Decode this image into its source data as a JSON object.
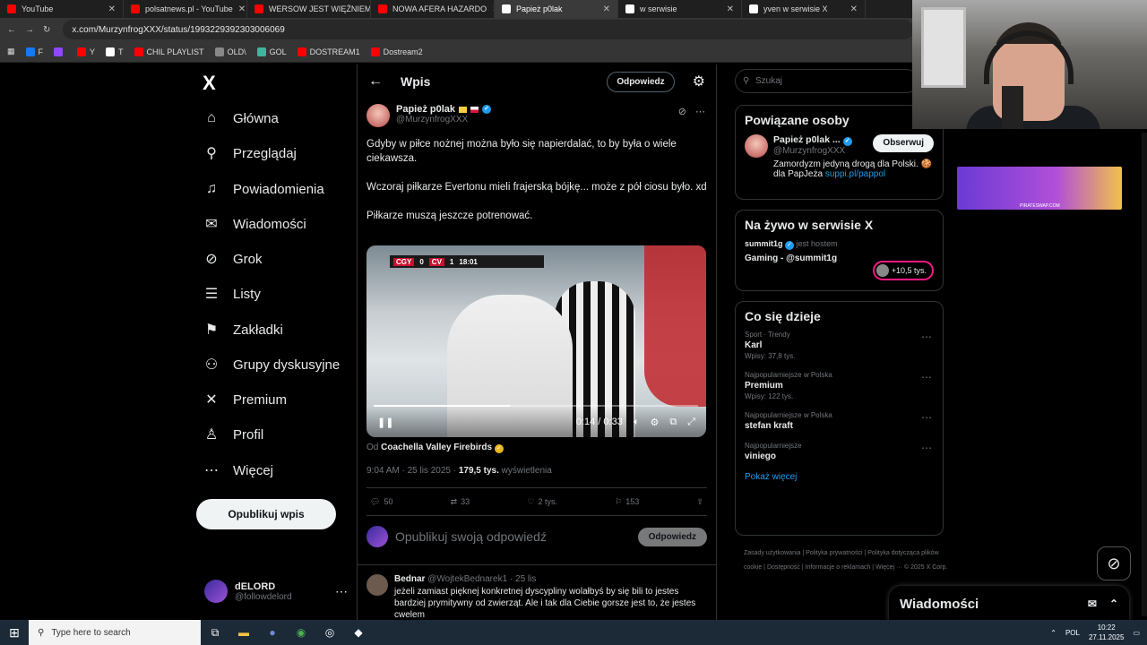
{
  "browser": {
    "tabs": [
      {
        "title": "YouTube",
        "color": "#ff0000",
        "active": false
      },
      {
        "title": "polsatnews.pl - YouTube",
        "color": "#ff0000",
        "active": false
      },
      {
        "title": "WERSOW JEST WIĘŹNIEM",
        "color": "#ff0000",
        "active": false
      },
      {
        "title": "NOWA AFERA HAZARDO",
        "color": "#ff0000",
        "active": false
      },
      {
        "title": "Papież p0lak",
        "color": "#ffffff",
        "active": true
      },
      {
        "title": "w serwisie",
        "color": "#ffffff",
        "active": false
      },
      {
        "title": "yven w serwisie X",
        "color": "#ffffff",
        "active": false
      }
    ],
    "url": "x.com/MurzynfrogXXX/status/1993229392303006069",
    "bookmarks": [
      {
        "label": "F",
        "color": "#1877f2"
      },
      {
        "label": "",
        "color": "#9146ff"
      },
      {
        "label": "Y",
        "color": "#ff0000"
      },
      {
        "label": "T",
        "color": "#ffffff"
      },
      {
        "label": "CHIL PLAYLIST",
        "color": "#ff0000"
      },
      {
        "label": "OLD\\",
        "color": "#888888"
      },
      {
        "label": "GOL",
        "color": "#3fb5a0"
      },
      {
        "label": "DOSTREAM1",
        "color": "#ff0000"
      },
      {
        "label": "Dostream2",
        "color": "#ff0000"
      }
    ]
  },
  "nav": {
    "logo": "X",
    "items": [
      {
        "label": "Główna",
        "icon": "⌂"
      },
      {
        "label": "Przeglądaj",
        "icon": "⚲"
      },
      {
        "label": "Powiadomienia",
        "icon": "♫"
      },
      {
        "label": "Wiadomości",
        "icon": "✉"
      },
      {
        "label": "Grok",
        "icon": "⊘"
      },
      {
        "label": "Listy",
        "icon": "☰"
      },
      {
        "label": "Zakładki",
        "icon": "⚑"
      },
      {
        "label": "Grupy dyskusyjne",
        "icon": "⚇"
      },
      {
        "label": "Premium",
        "icon": "✕"
      },
      {
        "label": "Profil",
        "icon": "♙"
      },
      {
        "label": "Więcej",
        "icon": "⋯"
      }
    ],
    "post_button": "Opublikuj wpis",
    "me": {
      "name": "dELORD",
      "handle": "@followdelord"
    }
  },
  "post": {
    "header_title": "Wpis",
    "reply_label": "Odpowiedz",
    "author_name": "Papież p0lak",
    "author_handle": "@MurzynfrogXXX",
    "text": [
      "Gdyby w piłce nożnej można było się napierdalać, to by była o wiele ciekawsza.",
      "Wczoraj piłkarze Evertonu mieli frajerską bójkę... może z pół ciosu było. xd",
      "Piłkarze muszą jeszcze potrenować."
    ],
    "video": {
      "team1": "CGY",
      "score1": "0",
      "team2": "CV",
      "score2": "1",
      "clock": "18:01",
      "time": "0:14 / 0:33",
      "progress": 0.42
    },
    "from_prefix": "Od",
    "from_name": "Coachella Valley Firebirds",
    "time": "9:04 AM · 25 lis 2025 ·",
    "views": "179,5 tys.",
    "views_label": "wyświetlenia",
    "stats": {
      "replies": "50",
      "reposts": "33",
      "likes": "2 tys.",
      "bookmarks": "153"
    },
    "reply_placeholder": "Opublikuj swoją odpowiedź",
    "reply_button": "Odpowiedz"
  },
  "reply": {
    "name": "Bednar",
    "handle": "@WojtekBednarek1 · 25 lis",
    "text": "jeżeli zamiast pięknej konkretnej dyscypliny wolałbyś by się bili to jestes bardziej prymitywny od zwierząt. Ale i tak dla Ciebie gorsze jest to, że jestes cwelem"
  },
  "sidebar": {
    "search_placeholder": "Szukaj",
    "related_title": "Powiązane osoby",
    "person": {
      "name": "Papież p0lak ...",
      "handle": "@MurzynfrogXXX",
      "follow": "Obserwuj",
      "bio": "Zamordyzm jedyną drogą dla Polski. 🍪 dla PapJeża",
      "bio_link": "suppi.pl/pappol"
    },
    "live_title": "Na żywo w serwisie X",
    "live_host": "summit1g",
    "live_host_label": "jest hostem",
    "live_name": "Gaming - @summit1g",
    "live_count": "+10,5 tys.",
    "trends_title": "Co się dzieje",
    "trends": [
      {
        "context": "Sport · Trendy",
        "name": "Karl",
        "posts": "Wpisy: 37,8 tys."
      },
      {
        "context": "Najpopularniejsze w Polska",
        "name": "Premium",
        "posts": "Wpisy: 122 tys."
      },
      {
        "context": "Najpopularniejsze w Polska",
        "name": "stefan kraft",
        "posts": ""
      },
      {
        "context": "Najpopularniejsze",
        "name": "viniego",
        "posts": ""
      }
    ],
    "show_more": "Pokaż więcej",
    "footer": "Zasady użytkowania | Polityka prywatności | Polityka dotycząca plików cookie | Dostępność | Informacje o reklamach | Więcej ··· © 2025 X Corp."
  },
  "overlay": {
    "ad_text": "PIRATESWAP.COM",
    "dm_title": "Wiadomości"
  },
  "taskbar": {
    "search_placeholder": "Type here to search",
    "lang": "POL",
    "time": "10:22",
    "date": "27.11.2025"
  }
}
